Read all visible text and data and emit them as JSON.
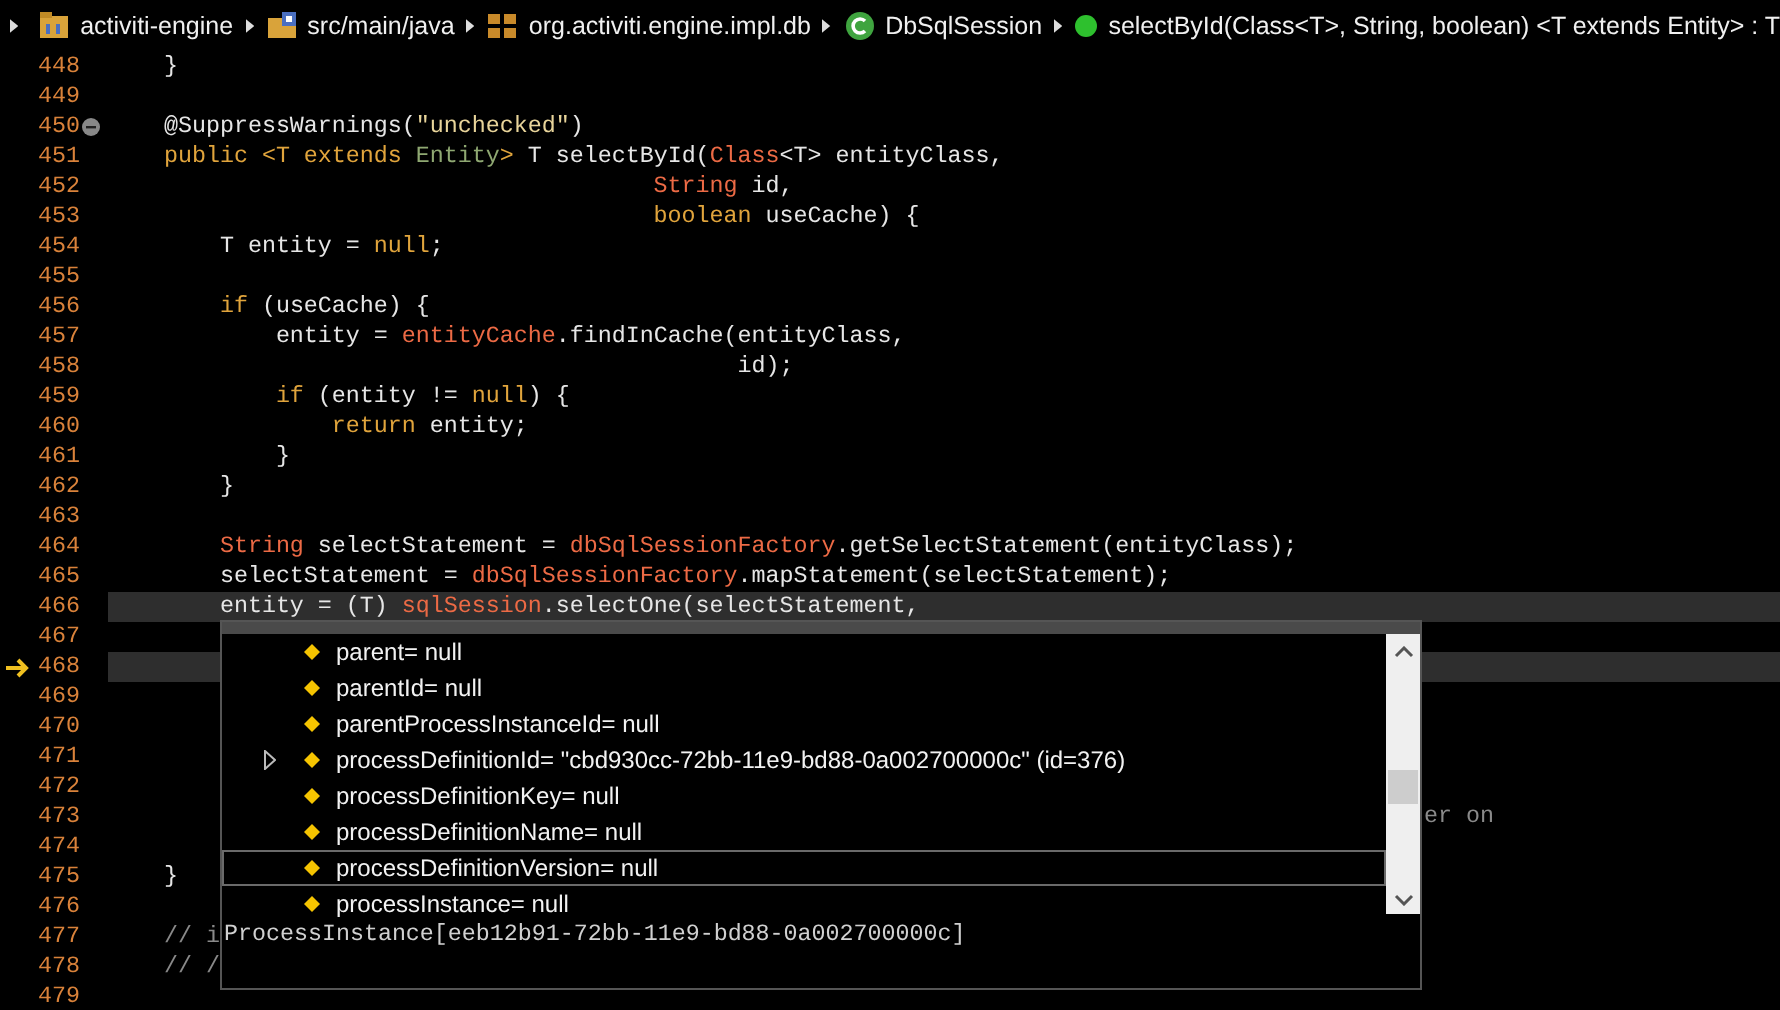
{
  "breadcrumb": [
    {
      "kind": "project",
      "label": "activiti-engine"
    },
    {
      "kind": "source-folder",
      "label": "src/main/java"
    },
    {
      "kind": "package",
      "label": "org.activiti.engine.impl.db"
    },
    {
      "kind": "class",
      "label": "DbSqlSession"
    },
    {
      "kind": "method",
      "label": "selectById(Class<T>, String, boolean) <T extends Entity> : T"
    }
  ],
  "editor": {
    "lines": [
      {
        "number": "448",
        "highlighted": false,
        "collapsible": false,
        "current_instruction": false,
        "tokens": [
          {
            "kind": "plain",
            "text": "    }"
          }
        ]
      },
      {
        "number": "449",
        "highlighted": false,
        "collapsible": false,
        "current_instruction": false
      },
      {
        "number": "450",
        "highlighted": false,
        "collapsible": true,
        "current_instruction": false,
        "tokens": [
          {
            "kind": "plain",
            "text": "    @SuppressWarnings("
          },
          {
            "kind": "string",
            "text": "\"unchecked\""
          },
          {
            "kind": "plain",
            "text": ")"
          }
        ]
      },
      {
        "number": "451",
        "highlighted": false,
        "collapsible": false,
        "current_instruction": false,
        "tokens": [
          {
            "kind": "keyword",
            "text": "    public <T extends "
          },
          {
            "kind": "type",
            "text": "Entity"
          },
          {
            "kind": "keyword",
            "text": ">"
          },
          {
            "kind": "plain",
            "text": " T selectById("
          },
          {
            "kind": "field",
            "text": "Class"
          },
          {
            "kind": "plain",
            "text": "<T> entityClass,"
          }
        ]
      },
      {
        "number": "452",
        "highlighted": false,
        "collapsible": false,
        "current_instruction": false,
        "tokens": [
          {
            "kind": "field",
            "text": "                                       String"
          },
          {
            "kind": "plain",
            "text": " id,"
          }
        ]
      },
      {
        "number": "453",
        "highlighted": false,
        "collapsible": false,
        "current_instruction": false,
        "tokens": [
          {
            "kind": "keyword",
            "text": "                                       boolean"
          },
          {
            "kind": "plain",
            "text": " useCache) {"
          }
        ]
      },
      {
        "number": "454",
        "highlighted": false,
        "collapsible": false,
        "current_instruction": false,
        "tokens": [
          {
            "kind": "plain",
            "text": "        T entity = "
          },
          {
            "kind": "keyword",
            "text": "null"
          },
          {
            "kind": "plain",
            "text": ";"
          }
        ]
      },
      {
        "number": "455",
        "highlighted": false,
        "collapsible": false,
        "current_instruction": false
      },
      {
        "number": "456",
        "highlighted": false,
        "collapsible": false,
        "current_instruction": false,
        "tokens": [
          {
            "kind": "keyword",
            "text": "        if"
          },
          {
            "kind": "plain",
            "text": " (useCache) {"
          }
        ]
      },
      {
        "number": "457",
        "highlighted": false,
        "collapsible": false,
        "current_instruction": false,
        "tokens": [
          {
            "kind": "plain",
            "text": "            entity = "
          },
          {
            "kind": "field",
            "text": "entityCache"
          },
          {
            "kind": "plain",
            "text": ".findInCache(entityClass,"
          }
        ]
      },
      {
        "number": "458",
        "highlighted": false,
        "collapsible": false,
        "current_instruction": false,
        "tokens": [
          {
            "kind": "plain",
            "text": "                                             id);"
          }
        ]
      },
      {
        "number": "459",
        "highlighted": false,
        "collapsible": false,
        "current_instruction": false,
        "tokens": [
          {
            "kind": "keyword",
            "text": "            if"
          },
          {
            "kind": "plain",
            "text": " (entity != "
          },
          {
            "kind": "keyword",
            "text": "null"
          },
          {
            "kind": "plain",
            "text": ") {"
          }
        ]
      },
      {
        "number": "460",
        "highlighted": false,
        "collapsible": false,
        "current_instruction": false,
        "tokens": [
          {
            "kind": "keyword",
            "text": "                return"
          },
          {
            "kind": "plain",
            "text": " entity;"
          }
        ]
      },
      {
        "number": "461",
        "highlighted": false,
        "collapsible": false,
        "current_instruction": false,
        "tokens": [
          {
            "kind": "plain",
            "text": "            }"
          }
        ]
      },
      {
        "number": "462",
        "highlighted": false,
        "collapsible": false,
        "current_instruction": false,
        "tokens": [
          {
            "kind": "plain",
            "text": "        }"
          }
        ]
      },
      {
        "number": "463",
        "highlighted": false,
        "collapsible": false,
        "current_instruction": false
      },
      {
        "number": "464",
        "highlighted": false,
        "collapsible": false,
        "current_instruction": false,
        "tokens": [
          {
            "kind": "field",
            "text": "        String"
          },
          {
            "kind": "plain",
            "text": " selectStatement = "
          },
          {
            "kind": "field",
            "text": "dbSqlSessionFactory"
          },
          {
            "kind": "plain",
            "text": ".getSelectStatement(entityClass);"
          }
        ]
      },
      {
        "number": "465",
        "highlighted": false,
        "collapsible": false,
        "current_instruction": false,
        "tokens": [
          {
            "kind": "plain",
            "text": "        selectStatement = "
          },
          {
            "kind": "field",
            "text": "dbSqlSessionFactory"
          },
          {
            "kind": "plain",
            "text": ".mapStatement(selectStatement);"
          }
        ]
      },
      {
        "number": "466",
        "highlighted": true,
        "collapsible": false,
        "current_instruction": false,
        "tokens": [
          {
            "kind": "plain",
            "text": "        entity = (T) "
          },
          {
            "kind": "field",
            "text": "sqlSession"
          },
          {
            "kind": "plain",
            "text": ".selectOne(selectStatement,"
          }
        ]
      },
      {
        "number": "467",
        "highlighted": false,
        "collapsible": false,
        "current_instruction": false
      },
      {
        "number": "468",
        "highlighted": true,
        "collapsible": false,
        "current_instruction": true
      },
      {
        "number": "469",
        "highlighted": false,
        "collapsible": false,
        "current_instruction": false
      },
      {
        "number": "470",
        "highlighted": false,
        "collapsible": false,
        "current_instruction": false
      },
      {
        "number": "471",
        "highlighted": false,
        "collapsible": false,
        "current_instruction": false
      },
      {
        "number": "472",
        "highlighted": false,
        "collapsible": false,
        "current_instruction": false
      },
      {
        "number": "473",
        "highlighted": false,
        "collapsible": false,
        "current_instruction": false,
        "tokens": [
          {
            "kind": "comment",
            "text": "er on"
          }
        ]
      },
      {
        "number": "474",
        "highlighted": false,
        "collapsible": false,
        "current_instruction": false
      },
      {
        "number": "475",
        "highlighted": false,
        "collapsible": false,
        "current_instruction": false,
        "tokens": [
          {
            "kind": "plain",
            "text": "    }"
          }
        ]
      },
      {
        "number": "476",
        "highlighted": false,
        "collapsible": false,
        "current_instruction": false
      },
      {
        "number": "477",
        "highlighted": false,
        "collapsible": false,
        "current_instruction": false,
        "tokens": [
          {
            "kind": "comment",
            "text": "    // i"
          }
        ]
      },
      {
        "number": "478",
        "highlighted": false,
        "collapsible": false,
        "current_instruction": false,
        "tokens": [
          {
            "kind": "comment",
            "text": "    // /"
          }
        ]
      },
      {
        "number": "479",
        "highlighted": false,
        "collapsible": false,
        "current_instruction": false
      }
    ]
  },
  "inspect_popup": {
    "items": [
      {
        "label": "parent= null",
        "expandable": false,
        "selected": false
      },
      {
        "label": "parentId= null",
        "expandable": false,
        "selected": false
      },
      {
        "label": "parentProcessInstanceId= null",
        "expandable": false,
        "selected": false
      },
      {
        "label": "processDefinitionId= \"cbd930cc-72bb-11e9-bd88-0a002700000c\" (id=376)",
        "expandable": true,
        "selected": false
      },
      {
        "label": "processDefinitionKey= null",
        "expandable": false,
        "selected": false
      },
      {
        "label": "processDefinitionName= null",
        "expandable": false,
        "selected": false
      },
      {
        "label": "processDefinitionVersion= null",
        "expandable": false,
        "selected": true
      },
      {
        "label": "processInstance= null",
        "expandable": false,
        "selected": false
      }
    ],
    "details": "ProcessInstance[eeb12b91-72bb-11e9-bd88-0a002700000c]"
  }
}
